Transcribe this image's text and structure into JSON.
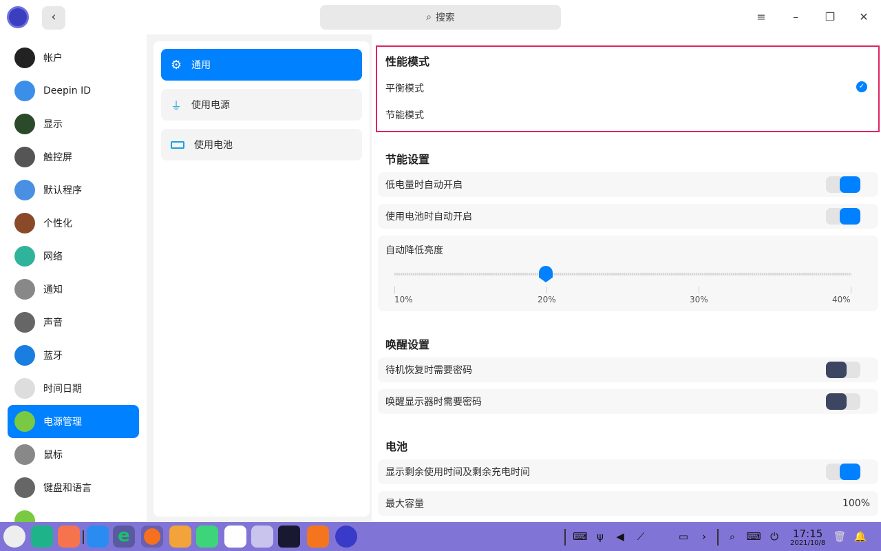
{
  "titlebar": {
    "search_label": "搜索"
  },
  "sidebar": {
    "items": [
      {
        "label": "帐户",
        "icon": "account-icon",
        "color": "#222"
      },
      {
        "label": "Deepin ID",
        "icon": "cloud-icon",
        "color": "#3b8fe8"
      },
      {
        "label": "显示",
        "icon": "display-icon",
        "color": "#2a4a2a"
      },
      {
        "label": "触控屏",
        "icon": "touchscreen-icon",
        "color": "#555"
      },
      {
        "label": "默认程序",
        "icon": "default-apps-icon",
        "color": "#4a90e2"
      },
      {
        "label": "个性化",
        "icon": "personalization-icon",
        "color": "#8a4a2a"
      },
      {
        "label": "网络",
        "icon": "network-icon",
        "color": "#2fb39a"
      },
      {
        "label": "通知",
        "icon": "notification-icon",
        "color": "#888"
      },
      {
        "label": "声音",
        "icon": "sound-icon",
        "color": "#666"
      },
      {
        "label": "蓝牙",
        "icon": "bluetooth-icon",
        "color": "#1a7ee0"
      },
      {
        "label": "时间日期",
        "icon": "clock-icon",
        "color": "#ddd"
      },
      {
        "label": "电源管理",
        "icon": "power-icon",
        "color": "#7ac943"
      },
      {
        "label": "鼠标",
        "icon": "mouse-icon",
        "color": "#888"
      },
      {
        "label": "键盘和语言",
        "icon": "keyboard-icon",
        "color": "#666"
      }
    ]
  },
  "mid": {
    "items": [
      {
        "label": "通用"
      },
      {
        "label": "使用电源"
      },
      {
        "label": "使用电池"
      }
    ]
  },
  "perf": {
    "title": "性能模式",
    "options": [
      "平衡模式",
      "节能模式"
    ]
  },
  "saving": {
    "title": "节能设置",
    "low_battery": "低电量时自动开启",
    "on_battery": "使用电池时自动开启",
    "brightness_label": "自动降低亮度",
    "ticks": [
      "10%",
      "20%",
      "30%",
      "40%"
    ],
    "brightness_value": "20%"
  },
  "wake": {
    "title": "唤醒设置",
    "standby": "待机恢复时需要密码",
    "display": "唤醒显示器时需要密码"
  },
  "battery": {
    "title": "电池",
    "show_time": "显示剩余使用时间及剩余充电时间",
    "capacity_label": "最大容量",
    "capacity_value": "100%"
  },
  "tray": {
    "time": "17:15",
    "date": "2021/10/8"
  },
  "accent": "#0081ff"
}
